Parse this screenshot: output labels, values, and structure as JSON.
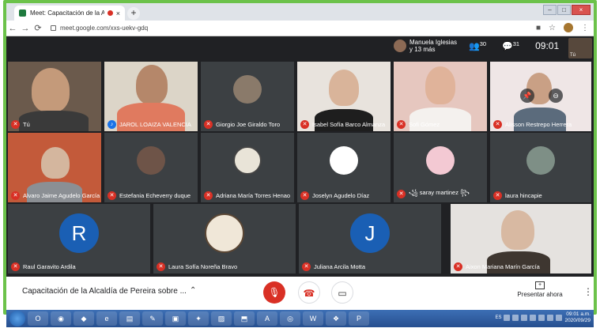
{
  "browser": {
    "tab_title": "Meet: Capacitación de la Alc",
    "tab_close": "×",
    "new_tab": "+",
    "url": "meet.google.com/xxs-uekv-gdq",
    "win_min": "–",
    "win_max": "□",
    "win_close": "×"
  },
  "meet": {
    "presenter_name": "Manuela Iglesias",
    "presenter_more": "y 13 más",
    "participants_count": "30",
    "chat_count": "31",
    "clock": "09:01",
    "self_label": "Tú"
  },
  "participants": [
    {
      "name": "Tú"
    },
    {
      "name": "JAROL LOAIZA VALENCIA"
    },
    {
      "name": "Giorgio Joe Giraldo Toro"
    },
    {
      "name": "Isabel Sofía Barco Almanza"
    },
    {
      "name": "Sofi Gómez"
    },
    {
      "name": "Alisson Restrepo Herrera"
    },
    {
      "name": "Alvaro Jaime Agudelo García"
    },
    {
      "name": "Estefania Echeverry duque"
    },
    {
      "name": "Adriana María Torres Henao"
    },
    {
      "name": "Joselyn Agudelo Díaz"
    },
    {
      "name": "꧁ saray martinez ꧂"
    },
    {
      "name": "laura hincapie"
    },
    {
      "name": "Raul Garavito Ardila",
      "initial": "R"
    },
    {
      "name": "Laura Sofía Noreña Bravo"
    },
    {
      "name": "Juliana Arcila Motta",
      "initial": "J"
    },
    {
      "name": "Aixon Mariana Marín García"
    }
  ],
  "bottombar": {
    "meeting_title": "Capacitación de la Alcaldía de Pereira sobre ...",
    "present_label": "Presentar ahora"
  },
  "taskbar": {
    "lang": "ES",
    "time": "09:01 a.m.",
    "date": "2020/09/29"
  },
  "colors": {
    "border": "#6cc24a",
    "meet_bg": "#202124",
    "tile_bg": "#3c4043",
    "danger": "#d93025",
    "accent_blue": "#1a5fb4"
  }
}
